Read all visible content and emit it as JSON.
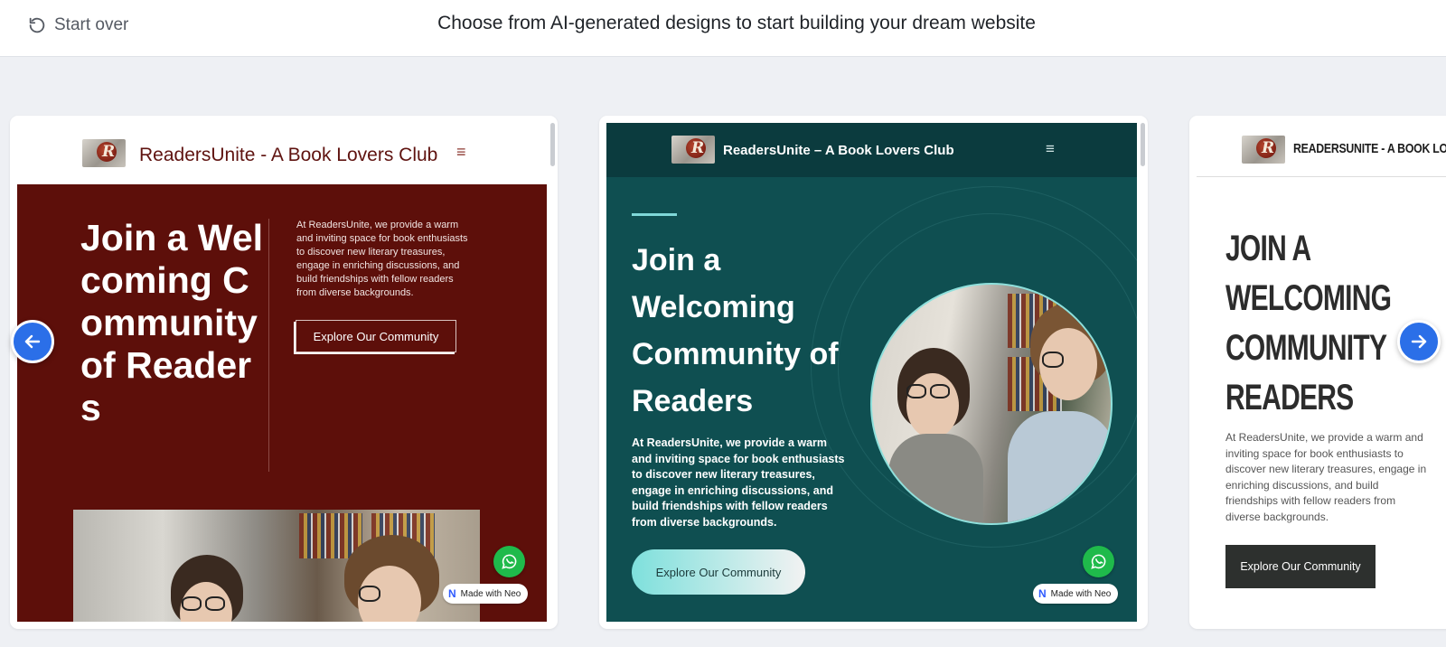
{
  "header": {
    "start_over_label": "Start over",
    "title": "Choose from AI-generated designs to start building your dream website"
  },
  "designs": [
    {
      "brand": "ReadersUnite - A Book Lovers Club",
      "headline": "Join a Welcoming Community of Readers",
      "description": "At ReadersUnite, we provide a warm and inviting space for book enthusiasts to discover new literary treasures, engage in enriching discussions, and build friendships with fellow readers from diverse backgrounds.",
      "cta": "Explore Our Community",
      "theme_color": "#5d0f0a",
      "badge": "Made with Neo"
    },
    {
      "brand": "ReadersUnite – A Book Lovers Club",
      "headline": "Join a Welcoming Community of Readers",
      "description": "At ReadersUnite, we provide a warm and inviting space for book enthusiasts to discover new literary treasures, engage in enriching discussions, and build friendships with fellow readers from diverse backgrounds.",
      "cta": "Explore Our Community",
      "theme_color": "#0f4f51",
      "badge": "Made with Neo"
    },
    {
      "brand": "READERSUNITE - A BOOK LOV",
      "headline": "JOIN A WELCOMING COMMUNITY READERS",
      "description": "At ReadersUnite, we provide a warm and inviting space for book enthusiasts to discover new literary treasures, engage in enriching discussions, and build friendships with fellow readers from diverse backgrounds.",
      "cta": "Explore Our Community",
      "theme_color": "#2d302e"
    }
  ],
  "logo_letter": "R",
  "menu_glyph": "≡",
  "icons": {
    "start_over": "rotate-ccw-icon",
    "prev": "arrow-left-icon",
    "next": "arrow-right-icon",
    "whatsapp": "whatsapp-icon",
    "neo": "neo-logo-icon"
  },
  "colors": {
    "accent": "#2b6fe8",
    "whatsapp": "#1fba4b",
    "page_bg": "#eef0f4"
  }
}
